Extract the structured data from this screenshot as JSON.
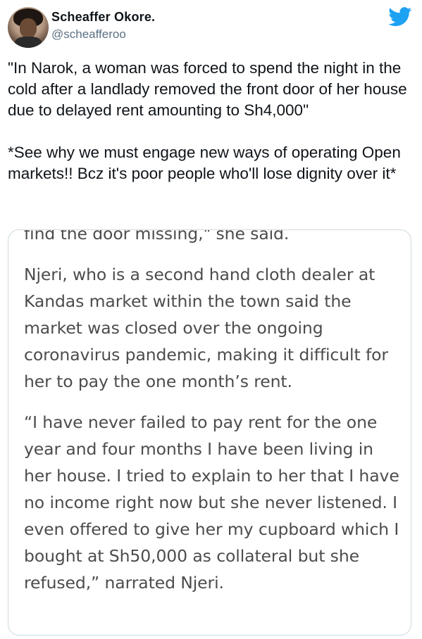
{
  "author": {
    "display_name": "Scheaffer Okore.",
    "handle": "@scheafferoo"
  },
  "tweet": {
    "text": "\"In Narok, a woman was forced to spend the night in the cold after a landlady removed the front door of her house due to delayed rent amounting to Sh4,000\"\n\n*See why we must engage new ways of operating Open markets!! Bcz it's poor people who'll lose dignity over it*"
  },
  "article": {
    "paragraph_1": "find the door missing,\" she said.",
    "paragraph_2": "Njeri, who is a second hand cloth dealer at Kandas market within the town said the market was closed over the ongoing coronavirus pandemic, making it difficult for her to pay the one month’s rent.",
    "paragraph_3": "“I have never failed to pay rent for the one year and four months I have been living in her house. I tried to explain to her that I have no income right now but she never listened. I even offered to give her my cupboard which I bought at Sh50,000 as collateral but she refused,” narrated Njeri."
  },
  "colors": {
    "twitter_blue": "#1da1f2",
    "handle_gray": "#5b7083",
    "card_border": "#cfd9de"
  },
  "icons": {
    "logo": "twitter-bird-icon"
  }
}
